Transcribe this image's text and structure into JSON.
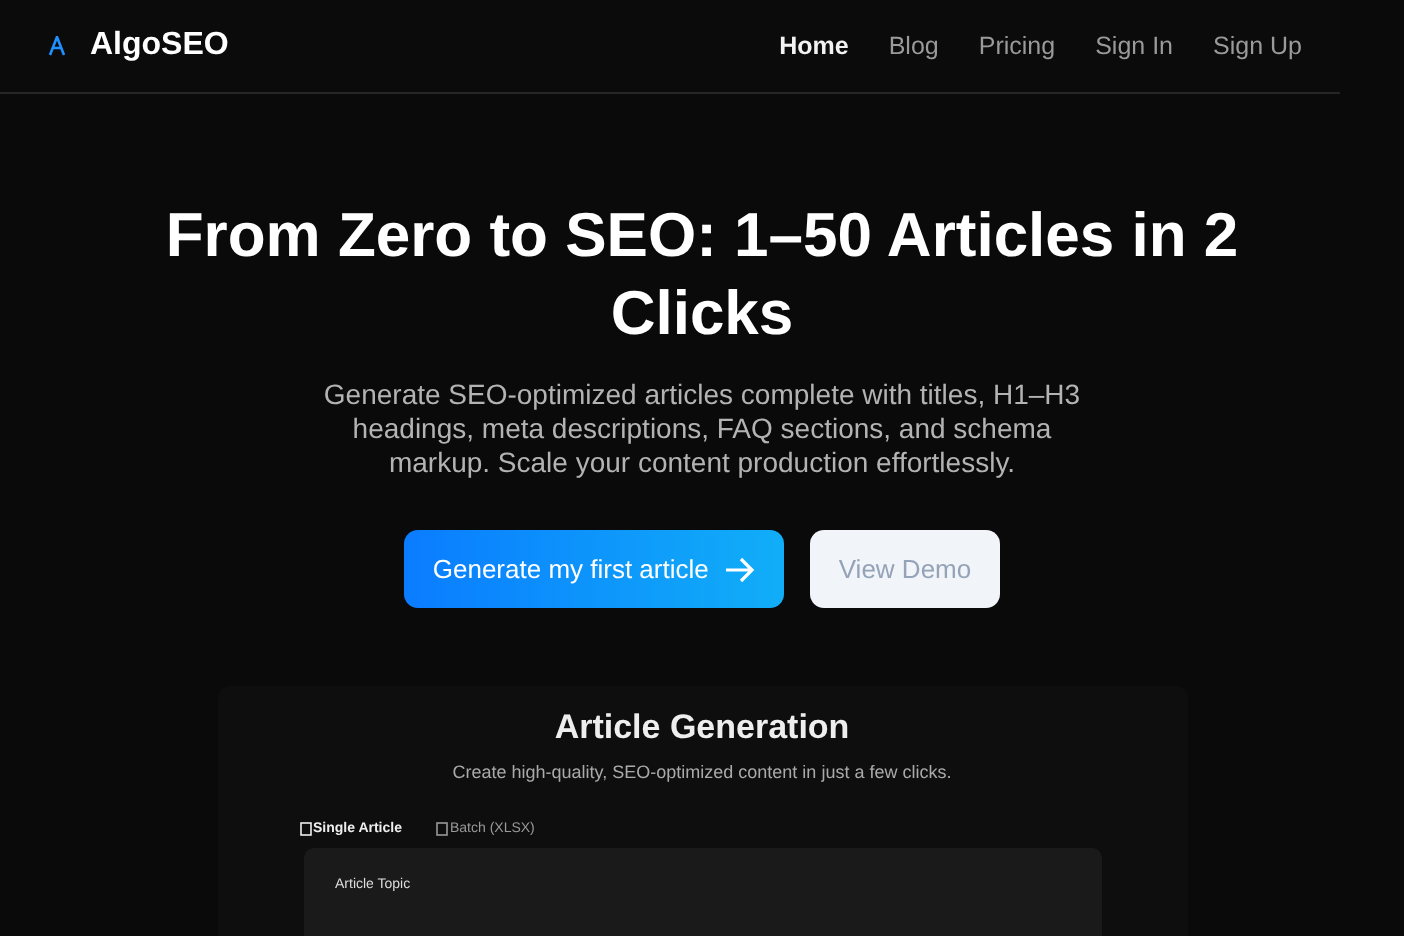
{
  "brand": {
    "name": "AlgoSEO"
  },
  "nav": [
    {
      "label": "Home",
      "selected": true
    },
    {
      "label": "Blog",
      "selected": false
    },
    {
      "label": "Pricing",
      "selected": false
    },
    {
      "label": "Sign In",
      "selected": false
    },
    {
      "label": "Sign Up",
      "selected": false
    }
  ],
  "hero": {
    "title": "From Zero to SEO: 1–50 Articles in 2 Clicks",
    "subtitle": "Generate SEO-optimized articles complete with titles, H1–H3 headings, meta descriptions, FAQ sections, and schema markup. Scale your content production effortlessly.",
    "primary_button": "Generate my first article",
    "secondary_button": "View Demo"
  },
  "preview": {
    "title": "Article Generation",
    "subtitle": "Create high-quality, SEO-optimized content in just a few clicks.",
    "tabs": [
      {
        "label": "Single Article",
        "selected": true
      },
      {
        "label": "Batch (XLSX)",
        "selected": false
      }
    ],
    "field_label": "Article Topic"
  }
}
